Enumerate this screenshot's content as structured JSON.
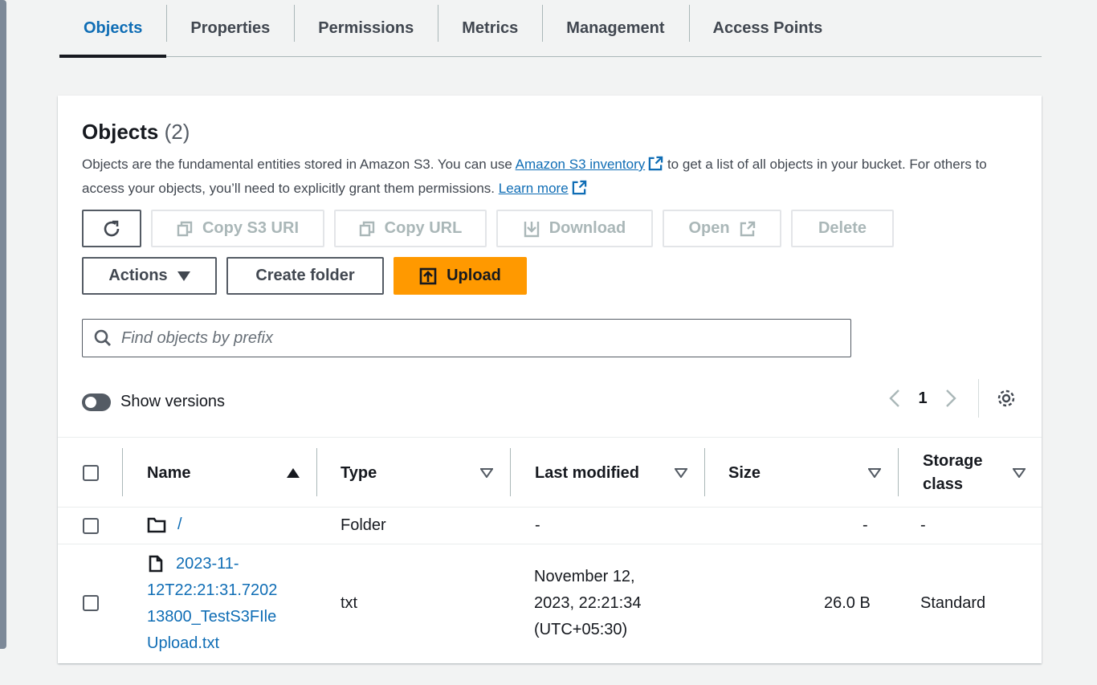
{
  "tabs": [
    "Objects",
    "Properties",
    "Permissions",
    "Metrics",
    "Management",
    "Access Points"
  ],
  "panel": {
    "title": "Objects",
    "count": "(2)",
    "desc_part1": "Objects are the fundamental entities stored in Amazon S3. You can use ",
    "desc_link1": "Amazon S3 inventory",
    "desc_part2": " to get a list of all objects in your bucket. For others to access your objects, you’ll need to explicitly grant them permissions. ",
    "desc_link2": "Learn more"
  },
  "toolbar": {
    "copy_s3_uri": "Copy S3 URI",
    "copy_url": "Copy URL",
    "download": "Download",
    "open": "Open",
    "delete": "Delete",
    "actions": "Actions",
    "create_folder": "Create folder",
    "upload": "Upload"
  },
  "search": {
    "placeholder": "Find objects by prefix"
  },
  "versions_label": "Show versions",
  "pagination": {
    "page": "1"
  },
  "columns": {
    "name": "Name",
    "type": "Type",
    "last_modified": "Last modified",
    "size": "Size",
    "storage_class_1": "Storage",
    "storage_class_2": "class"
  },
  "rows": [
    {
      "name": "/",
      "type": "Folder",
      "last_modified": "-",
      "size": "-",
      "storage_class": "-"
    },
    {
      "name_lines": [
        "2023-11-",
        "12T22:21:31.7202",
        "13800_TestS3FIle",
        "Upload.txt"
      ],
      "type": "txt",
      "last_modified_lines": [
        "November 12,",
        "2023, 22:21:34",
        "(UTC+05:30)"
      ],
      "size": "26.0 B",
      "storage_class": "Standard"
    }
  ],
  "colors": {
    "link": "#0f6db5",
    "primary": "#ff9900",
    "active_tab": "#0f6db5"
  }
}
